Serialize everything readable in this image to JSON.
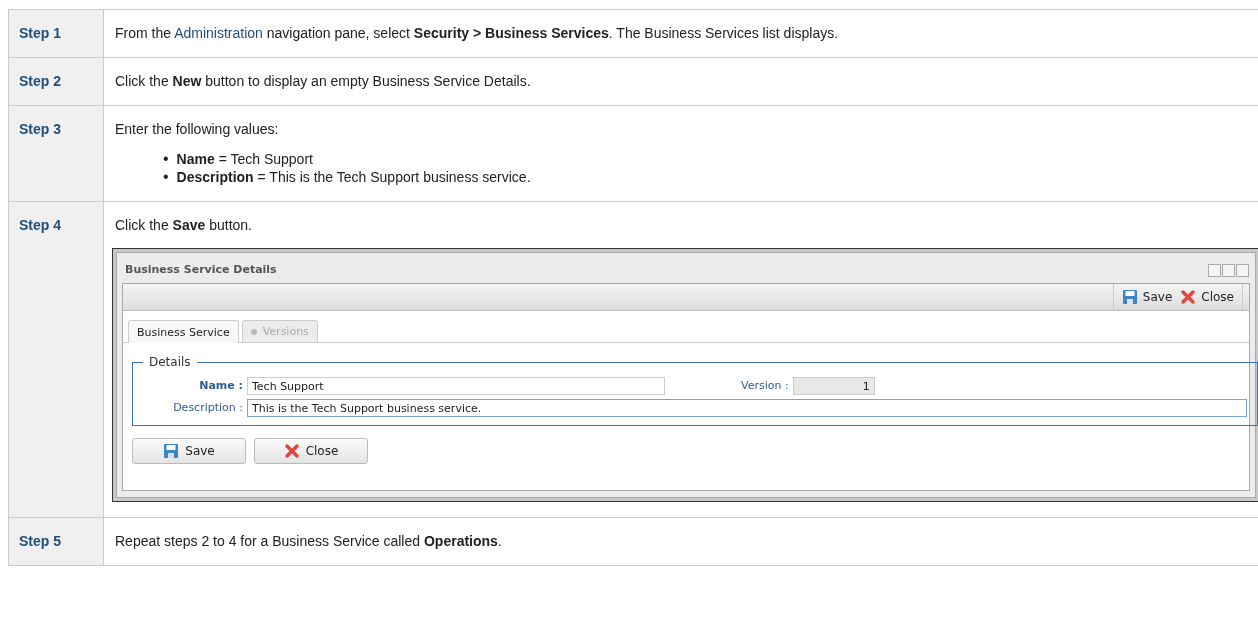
{
  "steps": [
    {
      "label": "Step 1",
      "kind": "link_sentence",
      "before": "From the",
      "link": "Administration",
      "after": "navigation pane, select **Security > Business Services**. The Business Services list displays."
    },
    {
      "label": "Step 2",
      "kind": "sentence",
      "text": "Click the **New** button to display an empty Business Service Details."
    },
    {
      "label": "Step 3",
      "kind": "bullets",
      "text": "Enter the following values:",
      "bullets": [
        {
          "marker": "•",
          "text": "**Name** = Tech Support"
        },
        {
          "marker": "•",
          "text": "**Description** = This is the Tech Support business service."
        }
      ]
    },
    {
      "label": "Step 4",
      "kind": "window",
      "text": "Click the **Save** button.",
      "window": {
        "title": "Business Service Details",
        "toolbar": [
          "Save",
          "Close"
        ],
        "tabs": [
          {
            "label": "Business Service",
            "selected": true,
            "disabled": false
          },
          {
            "label": "Versions",
            "selected": false,
            "disabled": true
          }
        ],
        "fieldset": "Details",
        "fields": {
          "name_label": "Name :",
          "name_value": "Tech Support",
          "version_label": "Version :",
          "version_value": "1",
          "description_label": "Description :",
          "description_value": "This is the Tech Support business service."
        },
        "buttons": [
          "Save",
          "Close"
        ]
      }
    },
    {
      "label": "Step 5",
      "kind": "sentence",
      "text": "Repeat steps 2 to 4 for a Business Service called **Operations**."
    }
  ]
}
